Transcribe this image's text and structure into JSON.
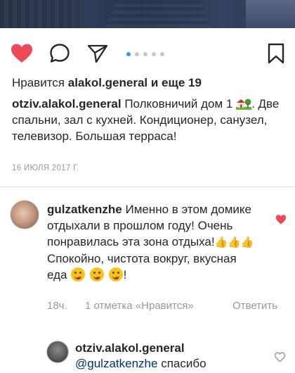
{
  "post": {
    "likes_prefix": "Нравится",
    "likes_user": "alakol.general",
    "likes_suffix": "и еще 19",
    "caption_user": "otziv.alakol.general",
    "caption_text_1": "Полковничий дом 1",
    "caption_emoji": "house-with-garden",
    "caption_text_2": ". Две спальни, зал с кухней. Кондиционер, санузел, телевизор. Большая терраса!",
    "date": "16 ИЮЛЯ 2017 Г."
  },
  "carousel": {
    "total": 5,
    "active": 1
  },
  "icons": {
    "like": "heart-filled-icon",
    "comment": "speech-bubble-icon",
    "share": "paper-plane-icon",
    "save": "bookmark-icon"
  },
  "colors": {
    "like_red": "#ed4956",
    "text": "#262626",
    "muted": "#999999",
    "mention": "#003569",
    "dot_active": "#3897f0"
  },
  "comment": {
    "user": "gulzatkenzhe",
    "text_1": "Именно в этом домике отдыхали в прошлом году! Очень понравилась эта зона отдыха!",
    "text_2": "Спокойно, чистота вокруг, вкусная еда",
    "text_3": "!",
    "time": "18ч.",
    "likes": "1 отметка «Нравится»",
    "reply_label": "Ответить"
  },
  "reply": {
    "user": "otziv.alakol.general",
    "mention": "@gulzatkenzhe",
    "text": "спасибо"
  }
}
